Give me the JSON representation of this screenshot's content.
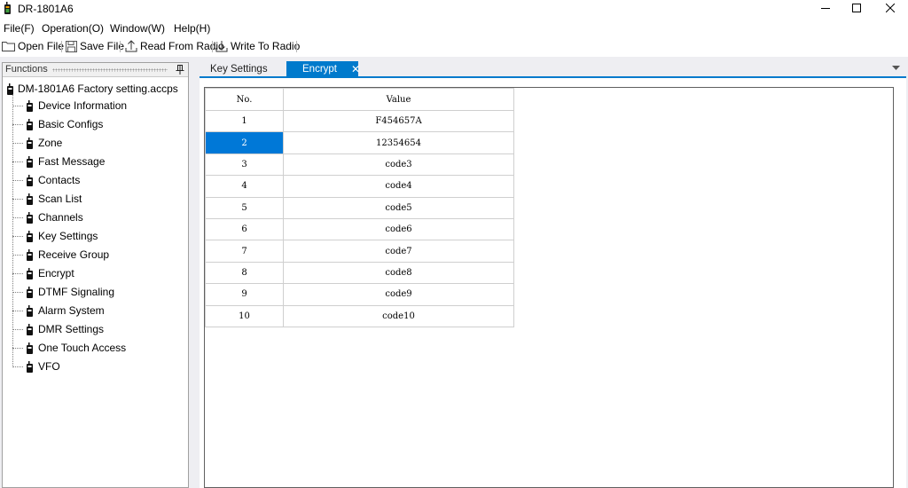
{
  "window": {
    "title": "DR-1801A6",
    "icon": "radio-icon",
    "controls": [
      "minimize-icon",
      "maximize-icon",
      "close-icon"
    ]
  },
  "menu": {
    "file": "File(F)",
    "operation": "Operation(O)",
    "window": "Window(W)",
    "help": "Help(H)"
  },
  "toolbar": {
    "open_file": "Open File",
    "save_file": "Save File",
    "read_from_radio": "Read From Radio",
    "write_to_radio": "Write To Radio"
  },
  "functions": {
    "title": "Functions",
    "root": "DM-1801A6 Factory setting.accps",
    "items": [
      "Device Information",
      "Basic Configs",
      "Zone",
      "Fast Message",
      "Contacts",
      "Scan List",
      "Channels",
      "Key Settings",
      "Receive Group",
      "Encrypt",
      "DTMF Signaling",
      "Alarm System",
      "DMR Settings",
      "One Touch Access",
      "VFO"
    ]
  },
  "tabs": {
    "key_settings": "Key Settings",
    "encrypt": "Encrypt",
    "active": "Encrypt",
    "close_glyph": "✕"
  },
  "encrypt_table": {
    "headers": {
      "no": "No.",
      "value": "Value"
    },
    "selected_row": 2,
    "rows": [
      {
        "no": "1",
        "value": "F454657A"
      },
      {
        "no": "2",
        "value": "12354654"
      },
      {
        "no": "3",
        "value": "code3"
      },
      {
        "no": "4",
        "value": "code4"
      },
      {
        "no": "5",
        "value": "code5"
      },
      {
        "no": "6",
        "value": "code6"
      },
      {
        "no": "7",
        "value": "code7"
      },
      {
        "no": "8",
        "value": "code8"
      },
      {
        "no": "9",
        "value": "code9"
      },
      {
        "no": "10",
        "value": "code10"
      }
    ]
  },
  "colors": {
    "accent": "#007acc",
    "selection": "#0078d7",
    "workspace": "#eeeef2"
  }
}
